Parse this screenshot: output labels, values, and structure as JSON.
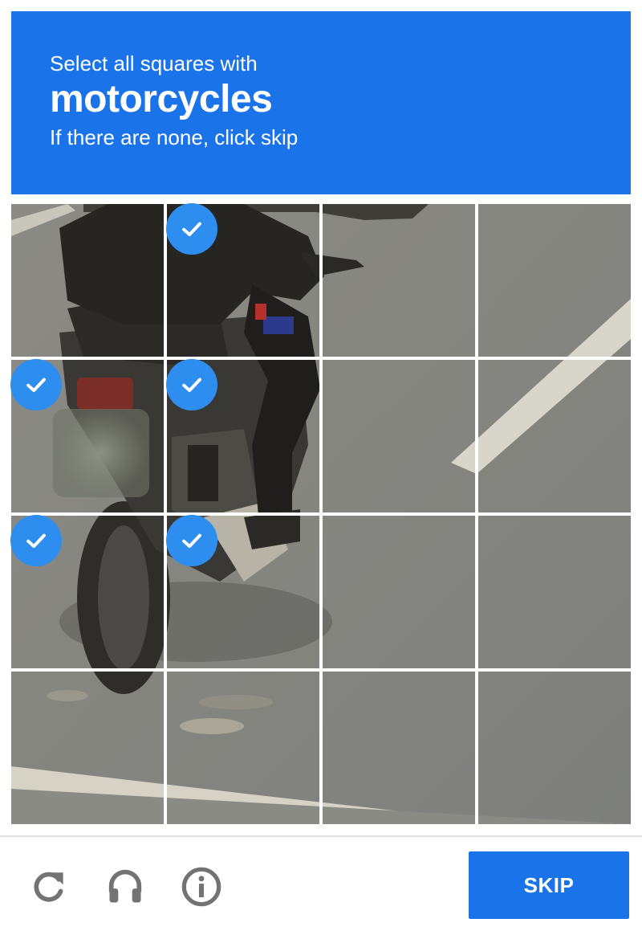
{
  "challenge": {
    "instruction_line1": "Select all squares with",
    "target_object": "motorcycles",
    "instruction_line3": "If there are none, click skip"
  },
  "grid": {
    "rows": 4,
    "cols": 4,
    "selected_tiles": [
      1,
      4,
      5,
      8,
      9
    ],
    "image_subject": "motorcycle rider on asphalt road with white lane markings"
  },
  "footer": {
    "reload_icon": "reload-icon",
    "audio_icon": "headphones-icon",
    "info_icon": "info-icon",
    "skip_label": "SKIP"
  },
  "colors": {
    "brand_blue": "#1a73e8",
    "check_blue": "#2d8ef0",
    "icon_gray": "#737373"
  }
}
